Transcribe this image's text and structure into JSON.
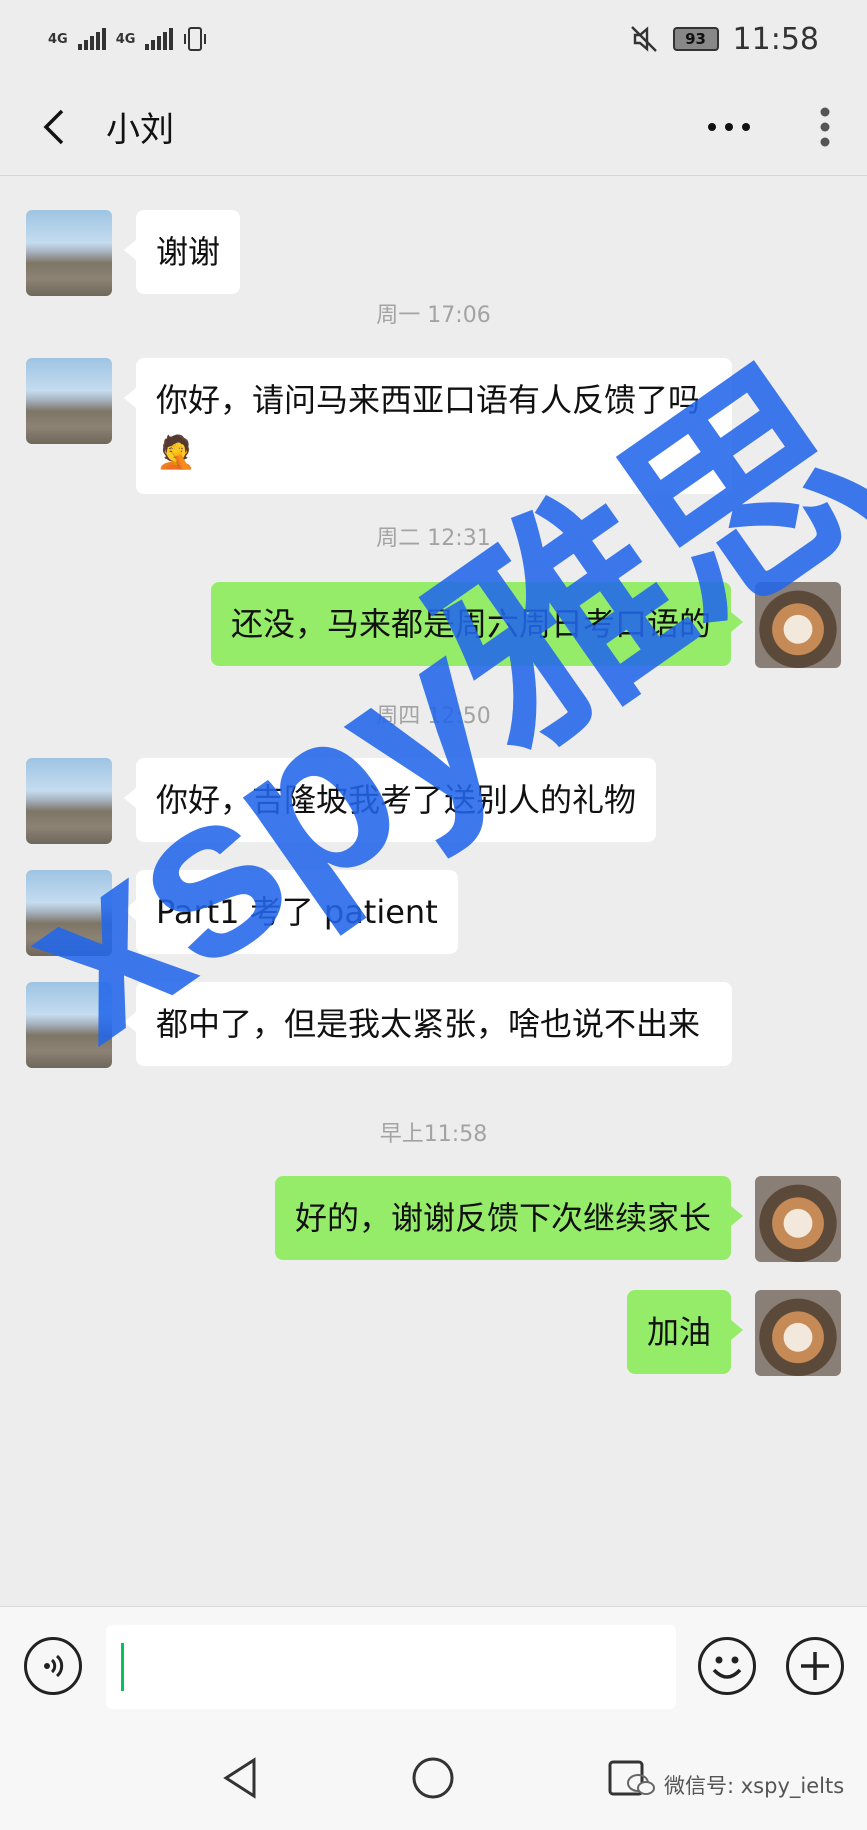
{
  "status_bar": {
    "network_1": "4G",
    "network_2": "4G",
    "battery": "93",
    "time": "11:58"
  },
  "header": {
    "title": "小刘"
  },
  "messages": [
    {
      "side": "in",
      "text": "谢谢"
    },
    {
      "side": "in",
      "text": "你好，请问马来西亚口语有人反馈了吗🤦"
    },
    {
      "side": "out",
      "text": "还没，马来都是周六周日考口语的"
    },
    {
      "side": "in",
      "text": "你好，吉隆坡我考了送别人的礼物"
    },
    {
      "side": "in",
      "text": "Part1 考了 patient"
    },
    {
      "side": "in",
      "text": "都中了，但是我太紧张，啥也说不出来"
    },
    {
      "side": "out",
      "text": "好的，谢谢反馈下次继续家长"
    },
    {
      "side": "out",
      "text": "加油"
    }
  ],
  "timestamps": [
    "周一 17:06",
    "周二 12:31",
    "周四 12:50",
    "早上11:58"
  ],
  "watermark": "xspy雅思",
  "footer_credit": "微信号: xspy_ielts",
  "icons": [
    "back-icon",
    "more-dots-icon",
    "vertical-more-icon",
    "voice-icon",
    "emoji-icon",
    "plus-icon",
    "nav-back-icon",
    "nav-home-icon",
    "nav-recent-icon"
  ],
  "colors": {
    "bubble_out": "#95ec69",
    "bubble_in": "#ffffff",
    "background": "#ededed",
    "watermark": "#2266eb"
  }
}
